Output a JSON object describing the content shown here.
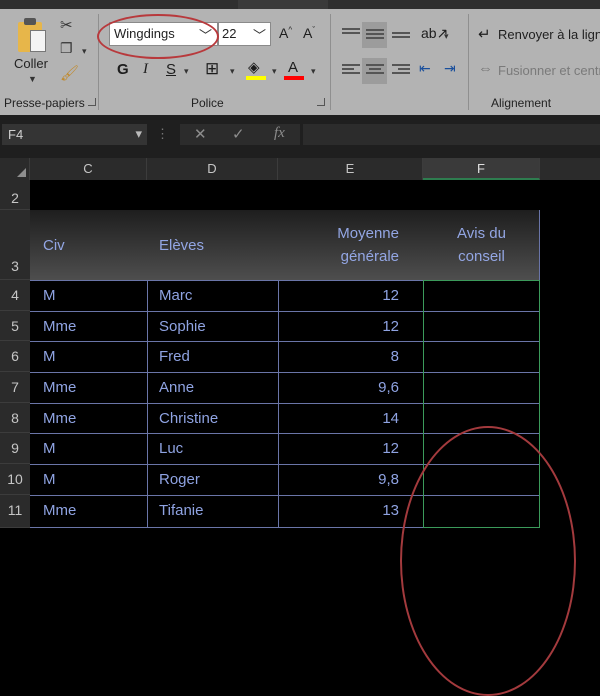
{
  "ribbon": {
    "clipboard": {
      "paste_label": "Coller",
      "group_label": "Presse-papiers"
    },
    "font": {
      "font_name": "Wingdings",
      "font_size": "22",
      "bold": "G",
      "italic": "I",
      "underline": "S",
      "group_label": "Police",
      "highlight_color": "#ffff00",
      "font_color": "#ff0000"
    },
    "alignment": {
      "wrap_label": "Renvoyer à la ligne",
      "merge_label": "Fusionner et centrer",
      "group_label": "Alignement"
    }
  },
  "formula_bar": {
    "name_box": "F4",
    "cancel": "✕",
    "enter": "✓",
    "fx": "fx",
    "formula": ""
  },
  "grid": {
    "columns": [
      "C",
      "D",
      "E",
      "F"
    ],
    "selected_column": "F",
    "rows": [
      "2",
      "3",
      "4",
      "5",
      "6",
      "7",
      "8",
      "9",
      "10",
      "11"
    ],
    "table_headers": {
      "civ": "Civ",
      "eleves": "Elèves",
      "moyenne_1": "Moyenne",
      "moyenne_2": "générale",
      "avis_1": "Avis du",
      "avis_2": "conseil"
    },
    "records": [
      {
        "civ": "M",
        "eleve": "Marc",
        "moyenne": "12",
        "avis": ""
      },
      {
        "civ": "Mme",
        "eleve": "Sophie",
        "moyenne": "12",
        "avis": ""
      },
      {
        "civ": "M",
        "eleve": "Fred",
        "moyenne": "8",
        "avis": ""
      },
      {
        "civ": "Mme",
        "eleve": "Anne",
        "moyenne": "9,6",
        "avis": ""
      },
      {
        "civ": "Mme",
        "eleve": "Christine",
        "moyenne": "14",
        "avis": ""
      },
      {
        "civ": "M",
        "eleve": "Luc",
        "moyenne": "12",
        "avis": ""
      },
      {
        "civ": "M",
        "eleve": "Roger",
        "moyenne": "9,8",
        "avis": ""
      },
      {
        "civ": "Mme",
        "eleve": "Tifanie",
        "moyenne": "13",
        "avis": ""
      }
    ]
  },
  "annotations": {
    "color": "#b8393c"
  }
}
